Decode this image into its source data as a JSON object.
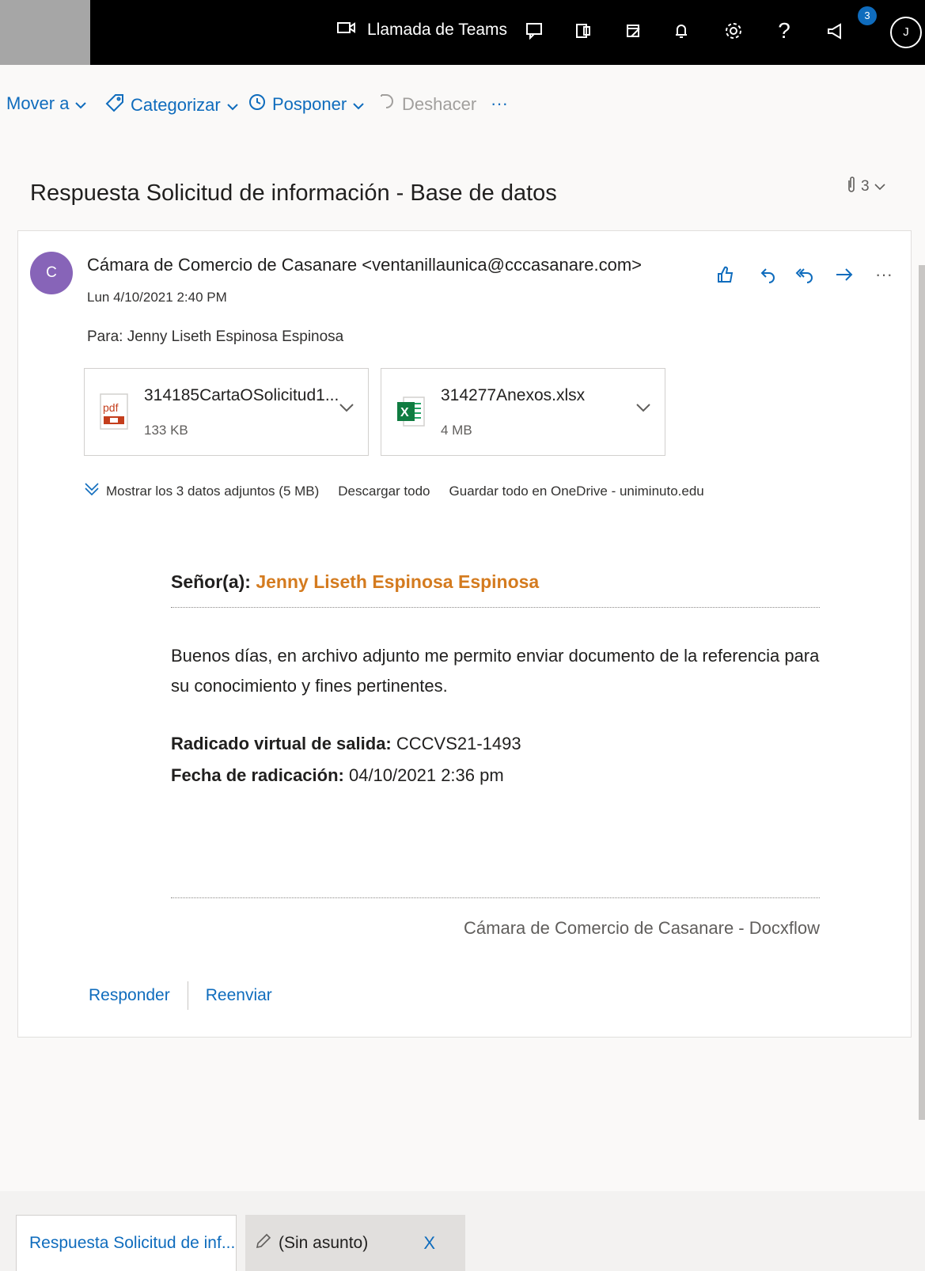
{
  "topbar": {
    "teams_label": "Llamada de Teams",
    "notif_count": "3",
    "avatar_initial": "J",
    "help": "?"
  },
  "commands": {
    "move": "Mover a",
    "categorize": "Categorizar",
    "snooze": "Posponer",
    "undo": "Deshacer",
    "more": "···"
  },
  "message": {
    "subject": "Respuesta Solicitud de información - Base de datos",
    "attachment_count": "3",
    "sender_initial": "C",
    "from": "Cámara de Comercio de Casanare <ventanillaunica@cccasanare.com>",
    "date": "Lun 4/10/2021 2:40 PM",
    "to": "Para:  Jenny Liseth Espinosa Espinosa",
    "more": "···"
  },
  "attachments": [
    {
      "name": "314185CartaOSolicitud1...",
      "size": "133 KB",
      "type": "pdf"
    },
    {
      "name": "314277Anexos.xlsx",
      "size": "4 MB",
      "type": "xlsx"
    }
  ],
  "attachment_links": {
    "show_all": "Mostrar los 3 datos adjuntos (5 MB)",
    "download_all": "Descargar todo",
    "save_onedrive": "Guardar todo en OneDrive - uniminuto.edu"
  },
  "body": {
    "greeting_label": "Señor(a): ",
    "greeting_name": "Jenny Liseth Espinosa Espinosa",
    "paragraph": "Buenos días, en archivo adjunto me permito enviar documento de la referencia para su conocimiento y fines pertinentes.",
    "radicado_label": "Radicado virtual de salida:",
    "radicado_value": " CCCVS21-1493",
    "fecha_label": "Fecha de radicación:",
    "fecha_value": " 04/10/2021 2:36 pm",
    "signature": "Cámara de Comercio de Casanare - Docxflow"
  },
  "reply": {
    "reply": "Responder",
    "forward": "Reenviar"
  },
  "tabs": {
    "active": "Respuesta Solicitud de inf...",
    "draft": "(Sin asunto)",
    "close": "X"
  },
  "colors": {
    "accent": "#0f6cbd",
    "avatar": "#8764b8",
    "name_highlight": "#d47b1f"
  }
}
